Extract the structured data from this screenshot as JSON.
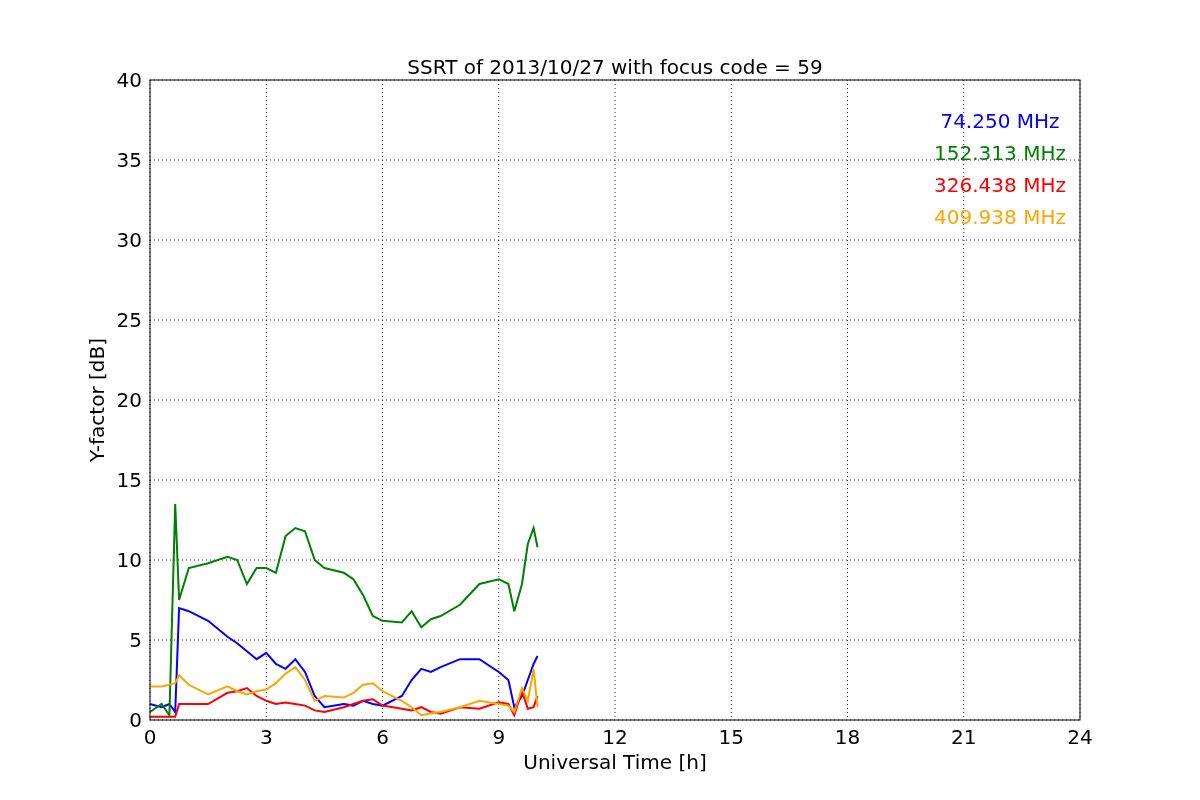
{
  "chart": {
    "chart_data": {
      "type": "line",
      "title": "SSRT of 2013/10/27 with focus code = 59",
      "xlabel": "Universal Time [h]",
      "ylabel": "Y-factor [dB]",
      "x": [
        0,
        0.3,
        0.5,
        0.65,
        0.75,
        1,
        1.5,
        2,
        2.25,
        2.5,
        2.75,
        3,
        3.25,
        3.5,
        3.75,
        4,
        4.25,
        4.5,
        5,
        5.25,
        5.5,
        5.75,
        6,
        6.5,
        6.75,
        7,
        7.25,
        7.5,
        8,
        8.5,
        9,
        9.25,
        9.4,
        9.6,
        9.75,
        9.9,
        10
      ],
      "series": [
        {
          "name": "74.250 MHz",
          "color": "#0000ff",
          "values": [
            1,
            0.8,
            1,
            0.5,
            7,
            6.8,
            6.2,
            5.2,
            4.8,
            4.3,
            3.8,
            4.2,
            3.5,
            3.2,
            3.8,
            3,
            1.5,
            0.8,
            1,
            0.9,
            1.2,
            1,
            0.9,
            1.5,
            2.5,
            3.2,
            3,
            3.3,
            3.8,
            3.8,
            3,
            2.5,
            0.8,
            1.5,
            2.5,
            3.5,
            4
          ]
        },
        {
          "name": "152.313 MHz",
          "color": "#008000",
          "values": [
            0.5,
            1,
            0.3,
            13.5,
            7.5,
            9.5,
            9.8,
            10.2,
            10,
            8.5,
            9.5,
            9.5,
            9.2,
            11.5,
            12,
            11.8,
            10,
            9.5,
            9.2,
            8.8,
            7.8,
            6.5,
            6.2,
            6.1,
            6.8,
            5.8,
            6.3,
            6.5,
            7.2,
            8.5,
            8.8,
            8.5,
            6.8,
            8.5,
            11,
            12,
            10.8
          ]
        },
        {
          "name": "326.438 MHz",
          "color": "#ff0000",
          "values": [
            0.2,
            0.2,
            0.2,
            0.2,
            1,
            1,
            1,
            1.7,
            1.8,
            2,
            1.5,
            1.2,
            1,
            1.1,
            1,
            0.9,
            0.6,
            0.5,
            0.8,
            1,
            1.2,
            1.3,
            0.9,
            0.7,
            0.6,
            0.8,
            0.5,
            0.4,
            0.8,
            0.7,
            1.1,
            1,
            0.3,
            1.8,
            0.7,
            0.8,
            1.5
          ]
        },
        {
          "name": "409.938 MHz",
          "color": "#ffa500",
          "values": [
            2.1,
            2.1,
            2.2,
            2.3,
            2.8,
            2.2,
            1.6,
            2.1,
            1.8,
            1.6,
            1.8,
            1.9,
            2.3,
            2.9,
            3.3,
            2.5,
            1.2,
            1.5,
            1.4,
            1.7,
            2.2,
            2.3,
            1.8,
            1.2,
            0.8,
            0.3,
            0.4,
            0.5,
            0.8,
            1.2,
            1,
            0.9,
            0.5,
            2,
            1.2,
            3.2,
            0.8
          ]
        }
      ],
      "grid": true,
      "xlim": [
        0,
        24
      ],
      "ylim": [
        0,
        40
      ],
      "xticks": [
        0,
        3,
        6,
        9,
        12,
        15,
        18,
        21,
        24
      ],
      "yticks": [
        0,
        5,
        10,
        15,
        20,
        25,
        30,
        35,
        40
      ]
    }
  }
}
